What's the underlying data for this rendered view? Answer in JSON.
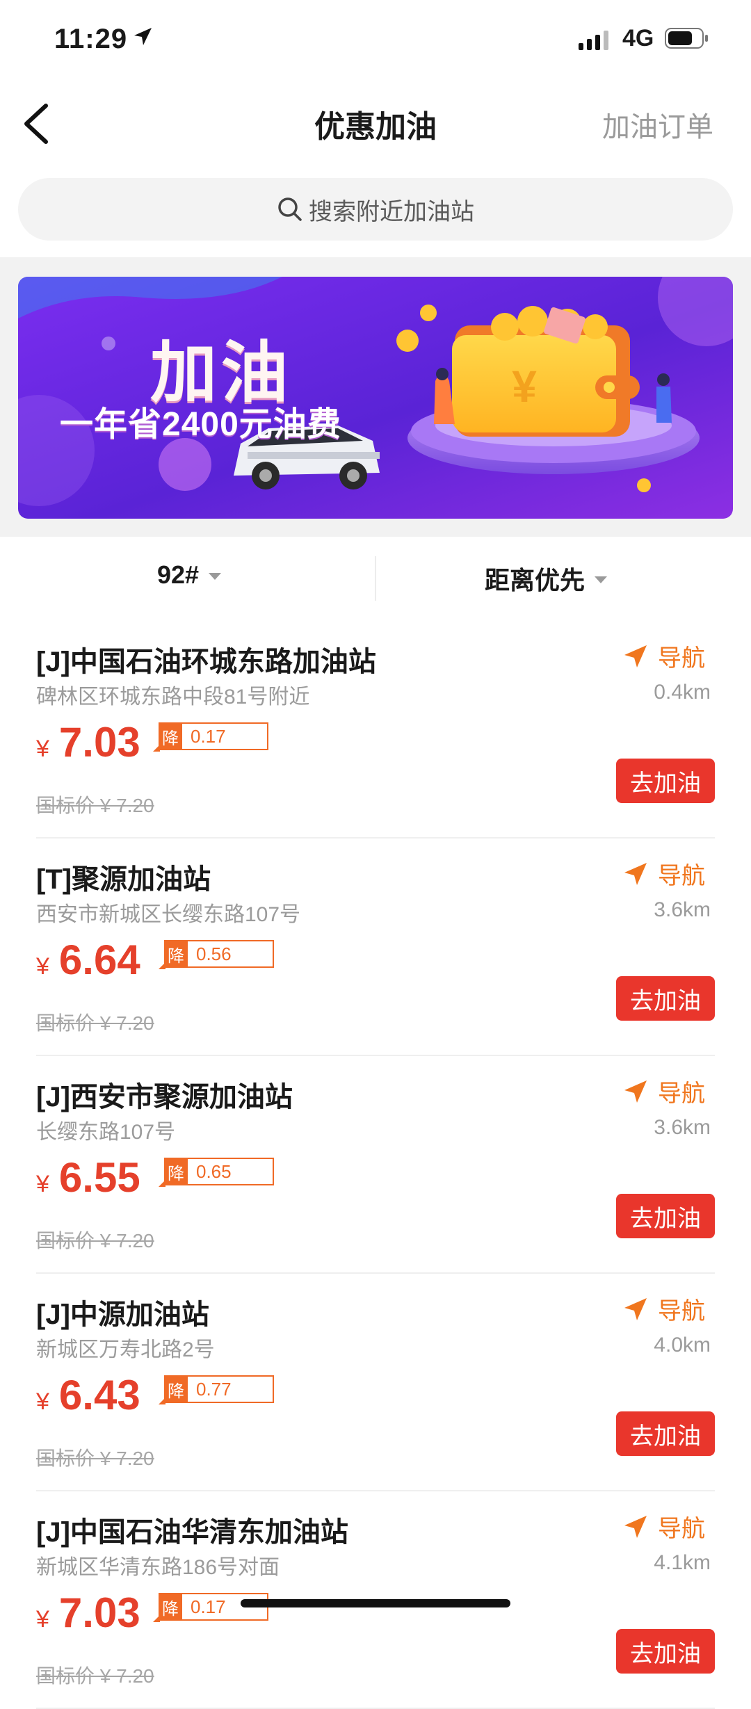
{
  "status": {
    "time": "11:29",
    "network": "4G"
  },
  "nav": {
    "title": "优惠加油",
    "orders": "加油订单"
  },
  "search": {
    "placeholder": "搜索附近加油站"
  },
  "banner": {
    "title": "加油",
    "subtitle": "一年省2400元油费",
    "coin_symbol": "¥"
  },
  "filters": {
    "fuel": "92#",
    "sort": "距离优先"
  },
  "station_labels": {
    "nav": "导航",
    "drop": "降",
    "go": "去加油",
    "yen": "¥"
  },
  "stations": [
    {
      "name": "[J]中国石油环城东路加油站",
      "address": "碑林区环城东路中段81号附近",
      "distance": "0.4km",
      "price": "7.03",
      "discount": "0.17",
      "guide_price": "国标价 ¥ 7.20"
    },
    {
      "name": "[T]聚源加油站",
      "address": "西安市新城区长缨东路107号",
      "distance": "3.6km",
      "price": "6.64",
      "discount": "0.56",
      "guide_price": "国标价 ¥ 7.20"
    },
    {
      "name": "[J]西安市聚源加油站",
      "address": "长缨东路107号",
      "distance": "3.6km",
      "price": "6.55",
      "discount": "0.65",
      "guide_price": "国标价 ¥ 7.20"
    },
    {
      "name": "[J]中源加油站",
      "address": "新城区万寿北路2号",
      "distance": "4.0km",
      "price": "6.43",
      "discount": "0.77",
      "guide_price": "国标价 ¥ 7.20"
    },
    {
      "name": "[J]中国石油华清东加油站",
      "address": "新城区华清东路186号对面",
      "distance": "4.1km",
      "price": "7.03",
      "discount": "0.17",
      "guide_price": "国标价 ¥ 7.20"
    }
  ],
  "colors": {
    "accent_red": "#e5402b",
    "accent_orange": "#f06a26",
    "button_red": "#e9362c"
  }
}
